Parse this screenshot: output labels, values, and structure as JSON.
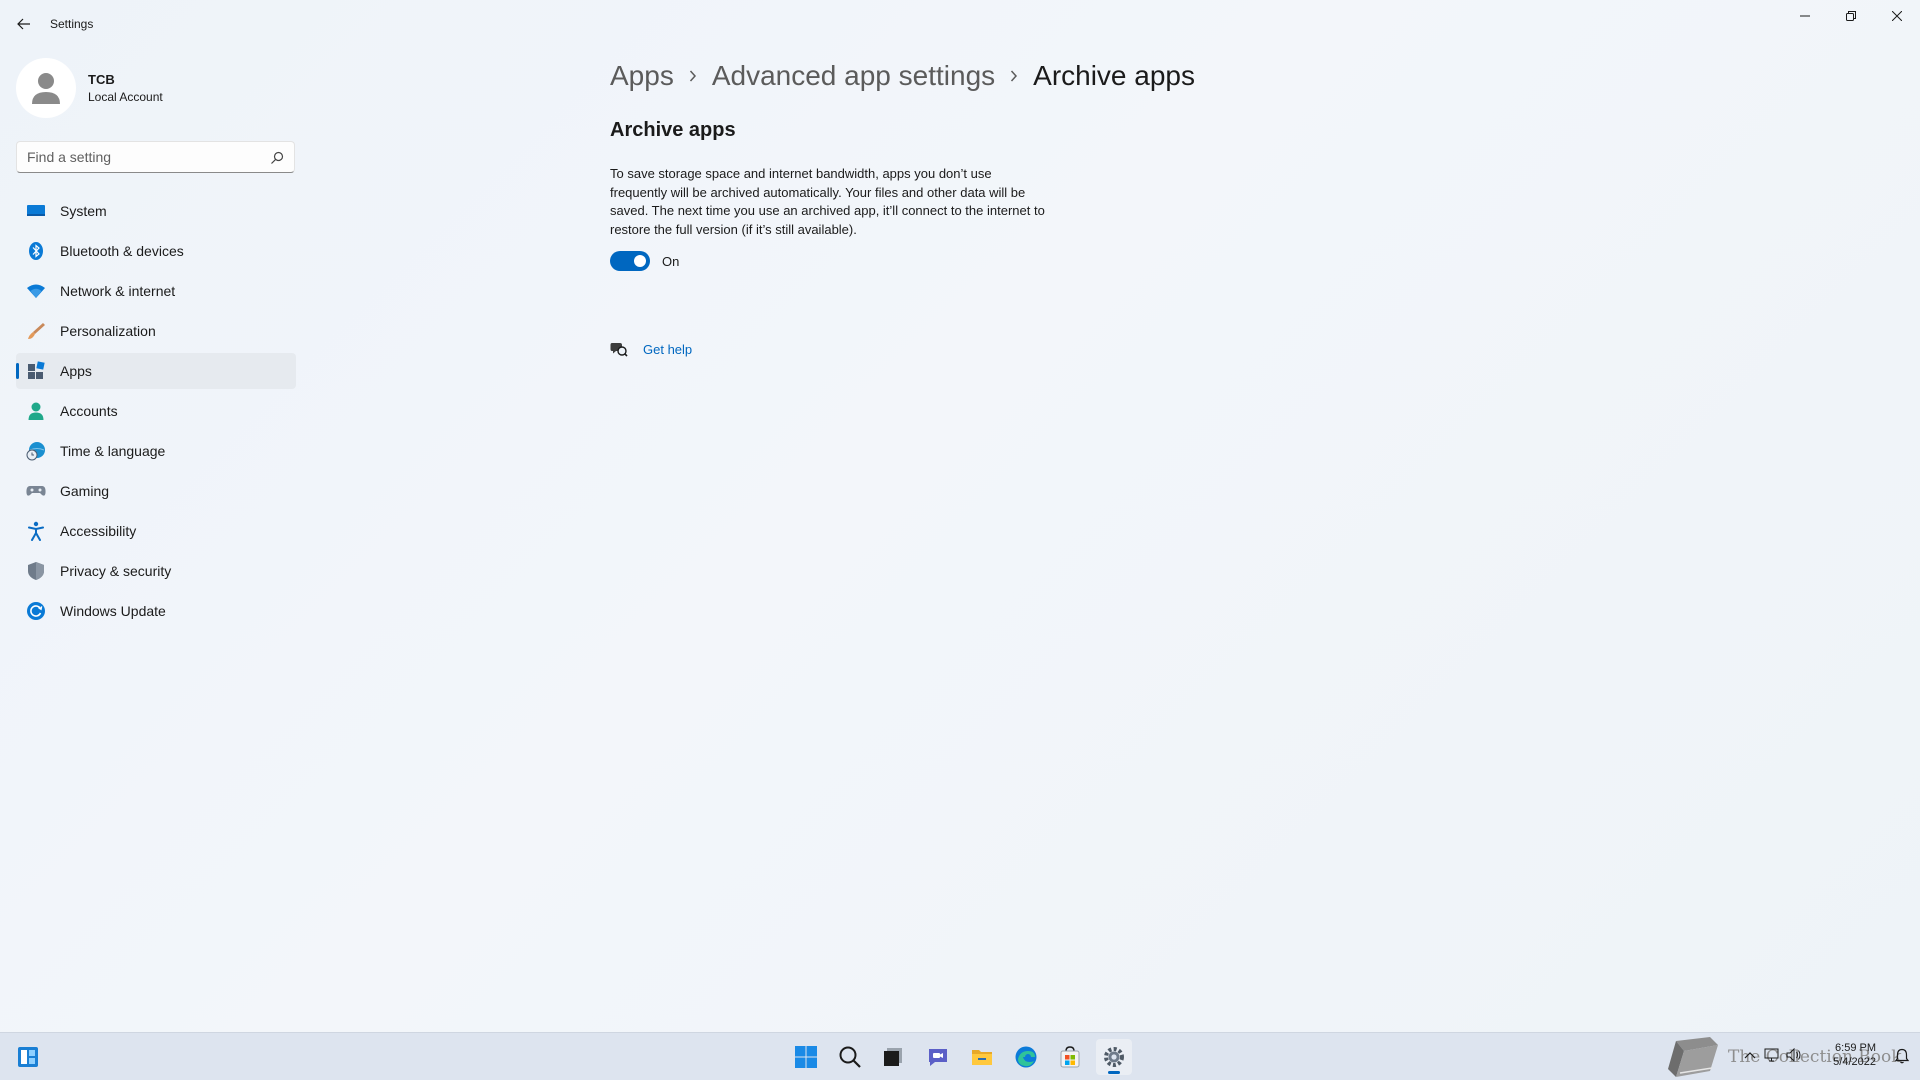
{
  "window": {
    "title": "Settings",
    "controls": [
      "minimize",
      "restore",
      "close"
    ]
  },
  "profile": {
    "name": "TCB",
    "account_type": "Local Account"
  },
  "search": {
    "placeholder": "Find a setting"
  },
  "sidebar": {
    "items": [
      {
        "label": "System",
        "icon": "system-icon"
      },
      {
        "label": "Bluetooth & devices",
        "icon": "bluetooth-icon"
      },
      {
        "label": "Network & internet",
        "icon": "wifi-icon"
      },
      {
        "label": "Personalization",
        "icon": "brush-icon"
      },
      {
        "label": "Apps",
        "icon": "apps-icon",
        "selected": true
      },
      {
        "label": "Accounts",
        "icon": "person-icon"
      },
      {
        "label": "Time & language",
        "icon": "globe-clock-icon"
      },
      {
        "label": "Gaming",
        "icon": "gamepad-icon"
      },
      {
        "label": "Accessibility",
        "icon": "accessibility-icon"
      },
      {
        "label": "Privacy & security",
        "icon": "shield-icon"
      },
      {
        "label": "Windows Update",
        "icon": "update-icon"
      }
    ]
  },
  "breadcrumb": [
    "Apps",
    "Advanced app settings",
    "Archive apps"
  ],
  "main": {
    "section_title": "Archive apps",
    "description": "To save storage space and internet bandwidth, apps you don’t use frequently will be archived automatically. Your files and other data will be saved. The next time you use an archived app, it’ll connect to the internet to restore the full version (if it’s still available).",
    "toggle": {
      "state": "On",
      "enabled": true
    },
    "help_link": "Get help"
  },
  "taskbar": {
    "apps": [
      "widgets",
      "start",
      "search",
      "task-view",
      "chat",
      "file-explorer",
      "edge",
      "store",
      "settings"
    ],
    "active_app": "settings",
    "watermark": "The Collection Book",
    "clock_time": "6:59 PM",
    "clock_date": "5/4/2022"
  },
  "colors": {
    "accent": "#0067c0",
    "background": "#eef3f9",
    "selected_nav": "#e6eaef",
    "taskbar": "#dde4ef"
  }
}
